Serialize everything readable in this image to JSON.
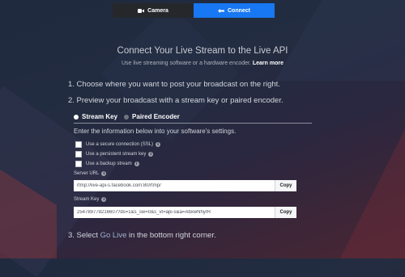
{
  "tabs": {
    "camera": {
      "label": "Camera",
      "icon": "video-camera-icon"
    },
    "connect": {
      "label": "Connect",
      "icon": "connect-icon",
      "active": true
    }
  },
  "header": {
    "title": "Connect Your Live Stream to the Live API",
    "subtitle": "Use live streaming software or a hardware encoder.",
    "learn_more": "Learn more"
  },
  "steps": {
    "step1": "1. Choose where you want to post your broadcast on the right.",
    "step2": "2. Preview your broadcast with a stream key or paired encoder.",
    "step3_prefix": "3. Select",
    "step3_link": "Go Live",
    "step3_suffix": "in the bottom right corner."
  },
  "mode_tabs": {
    "stream_key": {
      "label": "Stream Key",
      "selected": true
    },
    "paired_encoder": {
      "label": "Paired Encoder",
      "selected": false
    }
  },
  "instructions": "Enter the information below into your software's settings.",
  "options": [
    {
      "label": "Use a secure connection (SSL)",
      "checked": false
    },
    {
      "label": "Use a persistent stream key",
      "checked": false
    },
    {
      "label": "Use a backup stream",
      "checked": false
    }
  ],
  "server_url": {
    "label": "Server URL",
    "value": "rtmp://live-api-s.facebook.com:80/rtmp/",
    "copy_label": "Copy"
  },
  "stream_key": {
    "label": "Stream Key",
    "value": "254789778216607?ds=1&s_sw=0&s_vt=api-s&a=AbxwNhyrR",
    "copy_label": "Copy"
  },
  "colors": {
    "accent": "#1877f2",
    "tab_dark": "#26272b"
  }
}
